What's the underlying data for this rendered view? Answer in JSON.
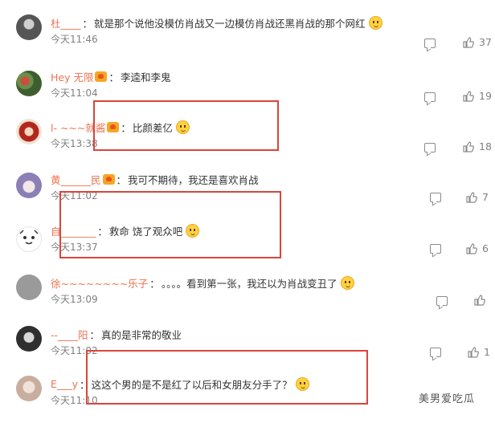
{
  "comments": [
    {
      "user": "杜____",
      "vip": false,
      "text": "就是那个说他没模仿肖战又一边模仿肖战还黑肖战的那个网红",
      "emoji": true,
      "time": "今天11:46",
      "likes": "37",
      "avatar_color": "#6a6a6a"
    },
    {
      "user": "Hey 无限",
      "vip": true,
      "text": "李逵和李鬼",
      "emoji": false,
      "time": "今天11:04",
      "likes": "19",
      "avatar_color": "#b43a2e"
    },
    {
      "user": "l- ~~~就酱",
      "vip": true,
      "text": "比颜差亿",
      "emoji": true,
      "time": "今天13:38",
      "likes": "18",
      "avatar_color": "#c0392b"
    },
    {
      "user": "黄______民",
      "vip": true,
      "text": "我可不期待，我还是喜欢肖战",
      "emoji": false,
      "time": "今天11:02",
      "likes": "7",
      "avatar_color": "#8c7fb5"
    },
    {
      "user": "自_______",
      "vip": false,
      "text": "救命 饶了观众吧",
      "emoji": true,
      "time": "今天13:37",
      "likes": "6",
      "avatar_color": "#e9e9e9"
    },
    {
      "user": "徐~~~~~~~~乐子",
      "vip": false,
      "text": "。。。。看到第一张，我还以为肖战变丑了",
      "emoji": true,
      "time": "今天13:09",
      "likes": "",
      "avatar_color": "#9a9a9a"
    },
    {
      "user": "--____阳",
      "vip": false,
      "text": "真的是非常的敬业",
      "emoji": false,
      "time": "今天11:02",
      "likes": "1",
      "avatar_color": "#3a3a3a"
    },
    {
      "user": "E___y",
      "vip": false,
      "text": "这这个男的是不是红了以后和女朋友分手了？",
      "emoji": true,
      "time": "今天11:10",
      "likes": "",
      "avatar_color": "#d7c3b8"
    }
  ],
  "watermark": "美男爱吃瓜",
  "colors": {
    "username": "#eb7350",
    "highlight_box": "#d9453c"
  }
}
